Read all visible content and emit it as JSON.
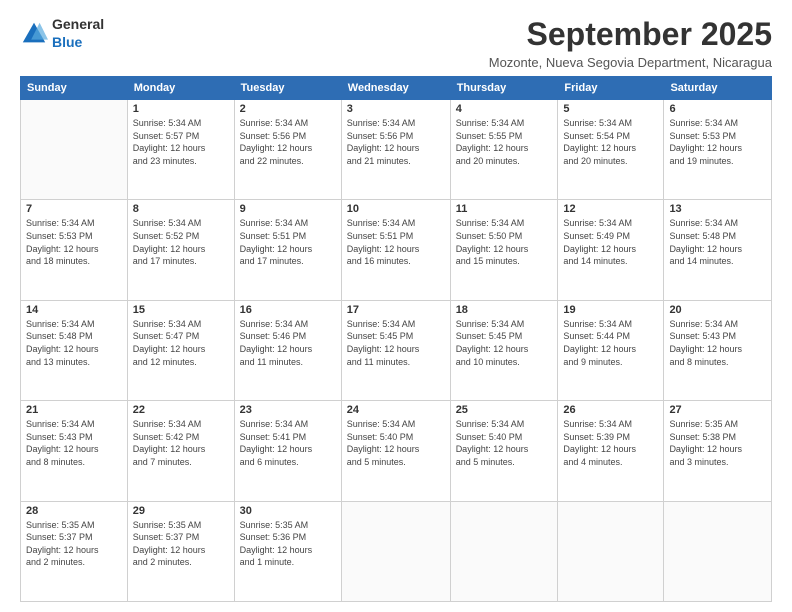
{
  "logo": {
    "general": "General",
    "blue": "Blue"
  },
  "title": "September 2025",
  "location": "Mozonte, Nueva Segovia Department, Nicaragua",
  "days_header": [
    "Sunday",
    "Monday",
    "Tuesday",
    "Wednesday",
    "Thursday",
    "Friday",
    "Saturday"
  ],
  "weeks": [
    [
      {
        "day": "",
        "info": ""
      },
      {
        "day": "1",
        "info": "Sunrise: 5:34 AM\nSunset: 5:57 PM\nDaylight: 12 hours\nand 23 minutes."
      },
      {
        "day": "2",
        "info": "Sunrise: 5:34 AM\nSunset: 5:56 PM\nDaylight: 12 hours\nand 22 minutes."
      },
      {
        "day": "3",
        "info": "Sunrise: 5:34 AM\nSunset: 5:56 PM\nDaylight: 12 hours\nand 21 minutes."
      },
      {
        "day": "4",
        "info": "Sunrise: 5:34 AM\nSunset: 5:55 PM\nDaylight: 12 hours\nand 20 minutes."
      },
      {
        "day": "5",
        "info": "Sunrise: 5:34 AM\nSunset: 5:54 PM\nDaylight: 12 hours\nand 20 minutes."
      },
      {
        "day": "6",
        "info": "Sunrise: 5:34 AM\nSunset: 5:53 PM\nDaylight: 12 hours\nand 19 minutes."
      }
    ],
    [
      {
        "day": "7",
        "info": "Sunrise: 5:34 AM\nSunset: 5:53 PM\nDaylight: 12 hours\nand 18 minutes."
      },
      {
        "day": "8",
        "info": "Sunrise: 5:34 AM\nSunset: 5:52 PM\nDaylight: 12 hours\nand 17 minutes."
      },
      {
        "day": "9",
        "info": "Sunrise: 5:34 AM\nSunset: 5:51 PM\nDaylight: 12 hours\nand 17 minutes."
      },
      {
        "day": "10",
        "info": "Sunrise: 5:34 AM\nSunset: 5:51 PM\nDaylight: 12 hours\nand 16 minutes."
      },
      {
        "day": "11",
        "info": "Sunrise: 5:34 AM\nSunset: 5:50 PM\nDaylight: 12 hours\nand 15 minutes."
      },
      {
        "day": "12",
        "info": "Sunrise: 5:34 AM\nSunset: 5:49 PM\nDaylight: 12 hours\nand 14 minutes."
      },
      {
        "day": "13",
        "info": "Sunrise: 5:34 AM\nSunset: 5:48 PM\nDaylight: 12 hours\nand 14 minutes."
      }
    ],
    [
      {
        "day": "14",
        "info": "Sunrise: 5:34 AM\nSunset: 5:48 PM\nDaylight: 12 hours\nand 13 minutes."
      },
      {
        "day": "15",
        "info": "Sunrise: 5:34 AM\nSunset: 5:47 PM\nDaylight: 12 hours\nand 12 minutes."
      },
      {
        "day": "16",
        "info": "Sunrise: 5:34 AM\nSunset: 5:46 PM\nDaylight: 12 hours\nand 11 minutes."
      },
      {
        "day": "17",
        "info": "Sunrise: 5:34 AM\nSunset: 5:45 PM\nDaylight: 12 hours\nand 11 minutes."
      },
      {
        "day": "18",
        "info": "Sunrise: 5:34 AM\nSunset: 5:45 PM\nDaylight: 12 hours\nand 10 minutes."
      },
      {
        "day": "19",
        "info": "Sunrise: 5:34 AM\nSunset: 5:44 PM\nDaylight: 12 hours\nand 9 minutes."
      },
      {
        "day": "20",
        "info": "Sunrise: 5:34 AM\nSunset: 5:43 PM\nDaylight: 12 hours\nand 8 minutes."
      }
    ],
    [
      {
        "day": "21",
        "info": "Sunrise: 5:34 AM\nSunset: 5:43 PM\nDaylight: 12 hours\nand 8 minutes."
      },
      {
        "day": "22",
        "info": "Sunrise: 5:34 AM\nSunset: 5:42 PM\nDaylight: 12 hours\nand 7 minutes."
      },
      {
        "day": "23",
        "info": "Sunrise: 5:34 AM\nSunset: 5:41 PM\nDaylight: 12 hours\nand 6 minutes."
      },
      {
        "day": "24",
        "info": "Sunrise: 5:34 AM\nSunset: 5:40 PM\nDaylight: 12 hours\nand 5 minutes."
      },
      {
        "day": "25",
        "info": "Sunrise: 5:34 AM\nSunset: 5:40 PM\nDaylight: 12 hours\nand 5 minutes."
      },
      {
        "day": "26",
        "info": "Sunrise: 5:34 AM\nSunset: 5:39 PM\nDaylight: 12 hours\nand 4 minutes."
      },
      {
        "day": "27",
        "info": "Sunrise: 5:35 AM\nSunset: 5:38 PM\nDaylight: 12 hours\nand 3 minutes."
      }
    ],
    [
      {
        "day": "28",
        "info": "Sunrise: 5:35 AM\nSunset: 5:37 PM\nDaylight: 12 hours\nand 2 minutes."
      },
      {
        "day": "29",
        "info": "Sunrise: 5:35 AM\nSunset: 5:37 PM\nDaylight: 12 hours\nand 2 minutes."
      },
      {
        "day": "30",
        "info": "Sunrise: 5:35 AM\nSunset: 5:36 PM\nDaylight: 12 hours\nand 1 minute."
      },
      {
        "day": "",
        "info": ""
      },
      {
        "day": "",
        "info": ""
      },
      {
        "day": "",
        "info": ""
      },
      {
        "day": "",
        "info": ""
      }
    ]
  ]
}
